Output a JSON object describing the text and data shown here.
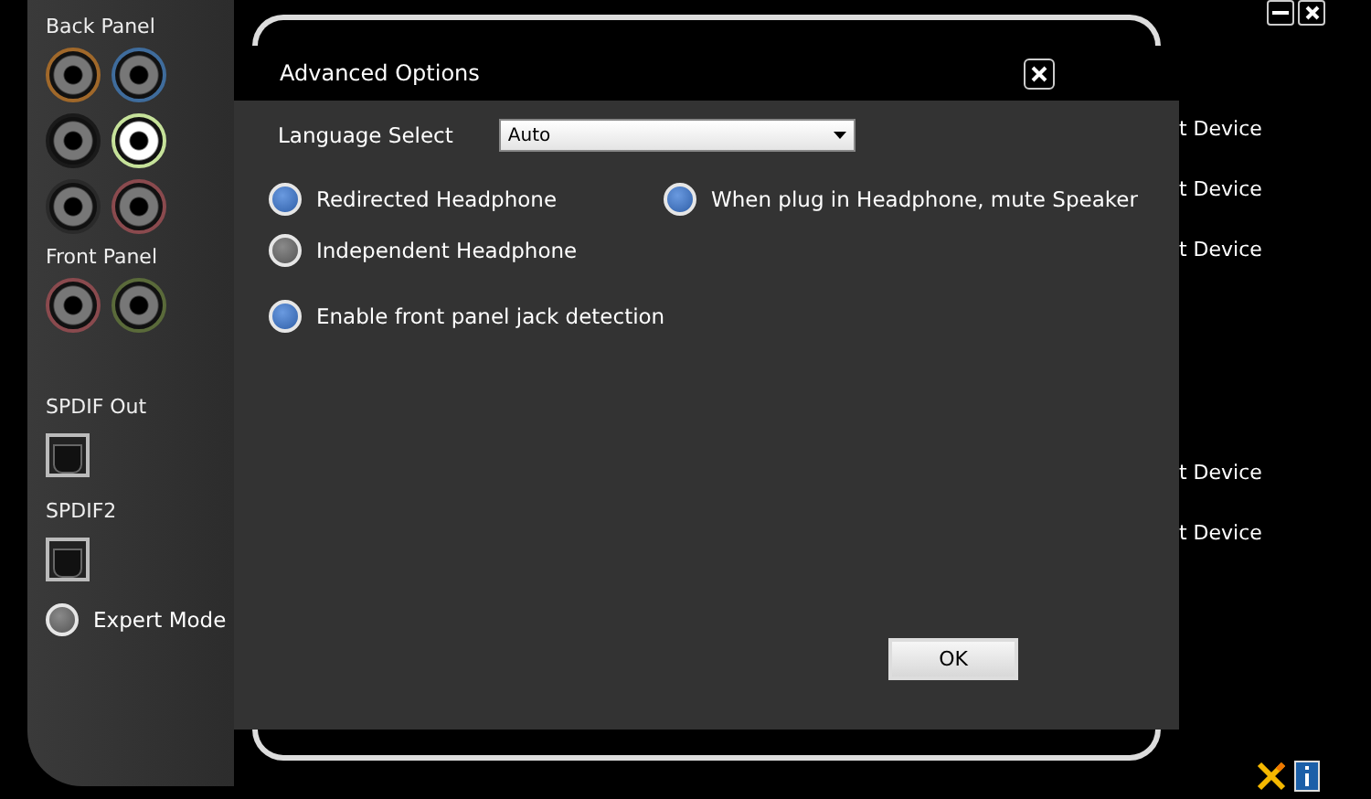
{
  "sidebar": {
    "back_panel": {
      "title": "Back Panel",
      "jacks": [
        {
          "color": "#a0682a",
          "plugged": false
        },
        {
          "color": "#3f6c9c",
          "plugged": false
        },
        {
          "color": "#1a1a1a",
          "plugged": false
        },
        {
          "color": "#c6e29a",
          "plugged": true
        },
        {
          "color": "#2a2a2a",
          "plugged": false
        },
        {
          "color": "#8a4a4e",
          "plugged": false
        }
      ]
    },
    "front_panel": {
      "title": "Front Panel",
      "jacks": [
        {
          "color": "#8a4a4e",
          "plugged": false
        },
        {
          "color": "#5a6a3a",
          "plugged": false
        }
      ]
    },
    "spdif": [
      {
        "label": "SPDIF Out"
      },
      {
        "label": "SPDIF2"
      }
    ],
    "expert_mode": {
      "label": "Expert Mode",
      "on": false
    }
  },
  "dialog": {
    "title": "Advanced Options",
    "language": {
      "label": "Language Select",
      "value": "Auto"
    },
    "options": [
      {
        "label": "Redirected Headphone",
        "on": true
      },
      {
        "label": "When plug in Headphone, mute Speaker",
        "on": true
      },
      {
        "label": "Independent Headphone",
        "on": false
      },
      {
        "label": "Enable front panel jack detection",
        "on": true
      }
    ],
    "ok": "OK"
  },
  "devices": [
    "t Device",
    "t Device",
    "t Device",
    "t Device",
    "t Device"
  ]
}
